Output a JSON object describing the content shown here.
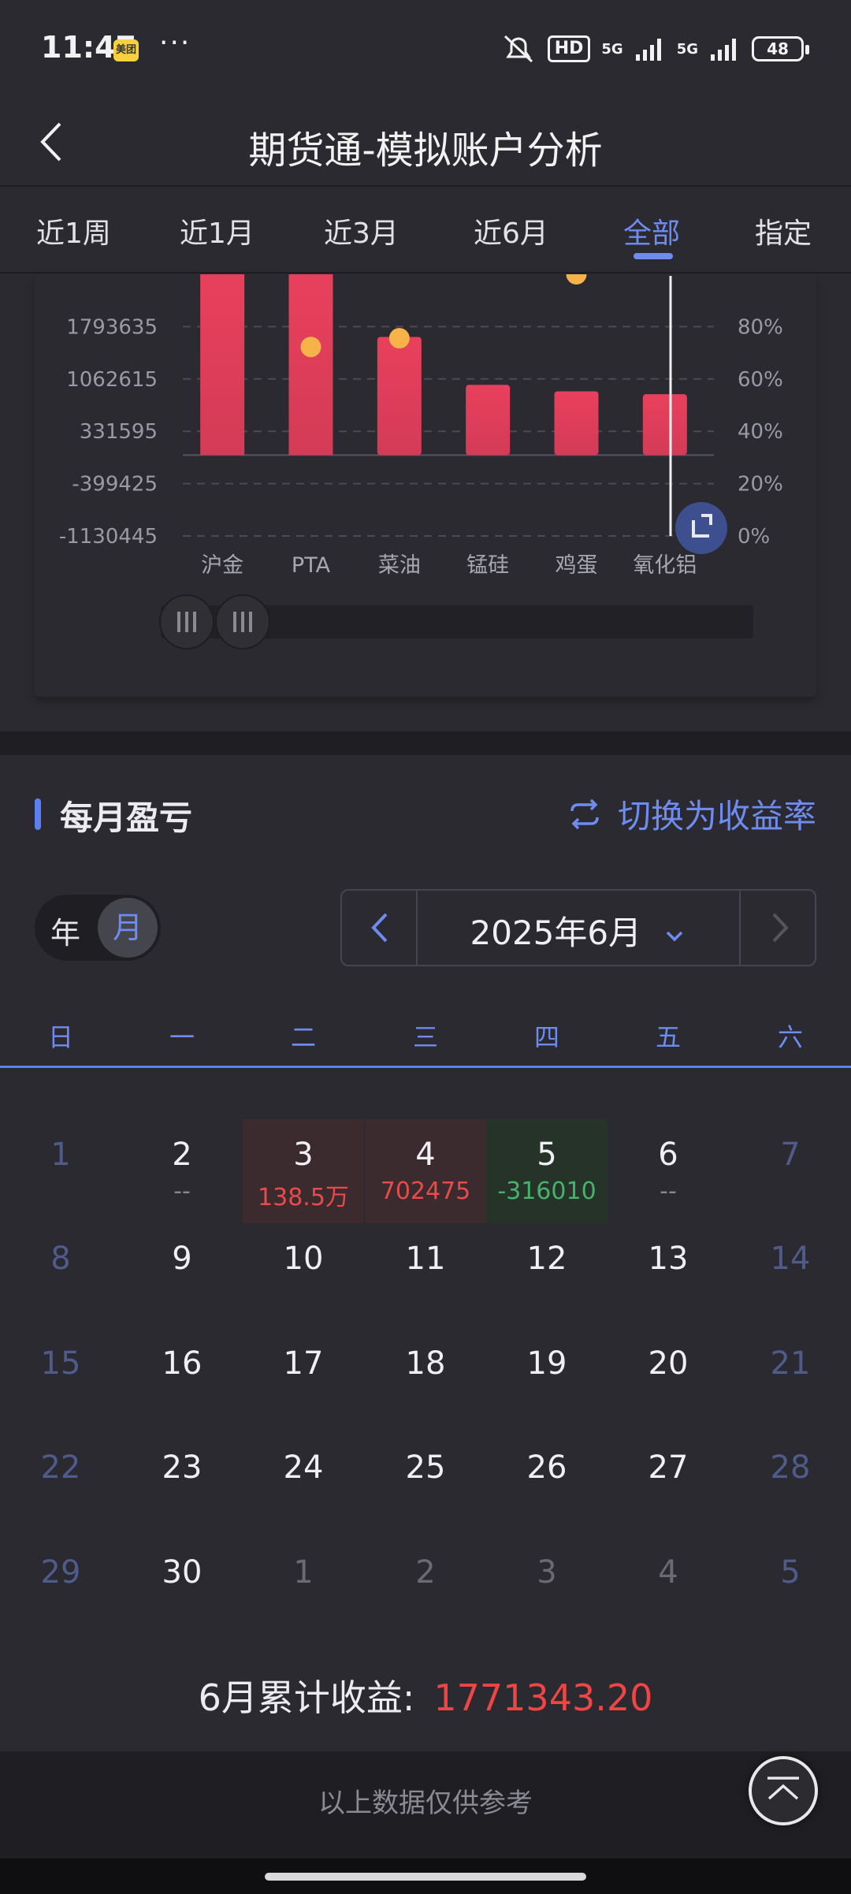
{
  "status_bar": {
    "time": "11:47",
    "app_badge": "美团",
    "dots": "···",
    "network": "HD",
    "net_5g_1": "5G",
    "net_5g_2": "5G",
    "battery": "48"
  },
  "header": {
    "title": "期货通-模拟账户分析"
  },
  "period_tabs": [
    {
      "label": "近1周",
      "active": false
    },
    {
      "label": "近1月",
      "active": false
    },
    {
      "label": "近3月",
      "active": false
    },
    {
      "label": "近6月",
      "active": false
    },
    {
      "label": "全部",
      "active": true
    },
    {
      "label": "指定",
      "active": false
    }
  ],
  "chart_data": {
    "type": "bar",
    "categories": [
      "沪金",
      "PTA",
      "菜油",
      "锰硅",
      "鸡蛋",
      "氧化铝"
    ],
    "values": [
      2524655,
      2524655,
      1650000,
      980000,
      890000,
      850000
    ],
    "rate_points": [
      null,
      65,
      68,
      null,
      90,
      null
    ],
    "y_left_ticks": [
      "1793635",
      "1062615",
      "331595",
      "-399425",
      "-1130445"
    ],
    "y_left_values": [
      1793635,
      1062615,
      331595,
      -399425,
      -1130445
    ],
    "y_right_ticks": [
      "80%",
      "60%",
      "40%",
      "20%",
      "0%"
    ],
    "ylim": [
      -1130445,
      2524655
    ],
    "y2lim": [
      0,
      90
    ],
    "bar_color": "#e8405c",
    "point_color": "#f7b24a",
    "grid": true
  },
  "monthly": {
    "title": "每月盈亏",
    "switch_label": "切换为收益率",
    "seg_year": "年",
    "seg_month": "月",
    "current_month": "2025年6月",
    "weekdays": [
      "日",
      "一",
      "二",
      "三",
      "四",
      "五",
      "六"
    ],
    "rows": [
      [
        {
          "d": "1",
          "v": "",
          "type": "weekend"
        },
        {
          "d": "2",
          "v": "--",
          "type": ""
        },
        {
          "d": "3",
          "v": "138.5万",
          "type": "up"
        },
        {
          "d": "4",
          "v": "702475",
          "type": "up"
        },
        {
          "d": "5",
          "v": "-316010",
          "type": "down"
        },
        {
          "d": "6",
          "v": "--",
          "type": ""
        },
        {
          "d": "7",
          "v": "",
          "type": "weekend"
        }
      ],
      [
        {
          "d": "8",
          "v": "",
          "type": "weekend"
        },
        {
          "d": "9",
          "v": "",
          "type": ""
        },
        {
          "d": "10",
          "v": "",
          "type": ""
        },
        {
          "d": "11",
          "v": "",
          "type": ""
        },
        {
          "d": "12",
          "v": "",
          "type": ""
        },
        {
          "d": "13",
          "v": "",
          "type": ""
        },
        {
          "d": "14",
          "v": "",
          "type": "weekend"
        }
      ],
      [
        {
          "d": "15",
          "v": "",
          "type": "weekend"
        },
        {
          "d": "16",
          "v": "",
          "type": ""
        },
        {
          "d": "17",
          "v": "",
          "type": ""
        },
        {
          "d": "18",
          "v": "",
          "type": ""
        },
        {
          "d": "19",
          "v": "",
          "type": ""
        },
        {
          "d": "20",
          "v": "",
          "type": ""
        },
        {
          "d": "21",
          "v": "",
          "type": "weekend"
        }
      ],
      [
        {
          "d": "22",
          "v": "",
          "type": "weekend"
        },
        {
          "d": "23",
          "v": "",
          "type": ""
        },
        {
          "d": "24",
          "v": "",
          "type": ""
        },
        {
          "d": "25",
          "v": "",
          "type": ""
        },
        {
          "d": "26",
          "v": "",
          "type": ""
        },
        {
          "d": "27",
          "v": "",
          "type": ""
        },
        {
          "d": "28",
          "v": "",
          "type": "weekend"
        }
      ],
      [
        {
          "d": "29",
          "v": "",
          "type": "weekend"
        },
        {
          "d": "30",
          "v": "",
          "type": ""
        },
        {
          "d": "1",
          "v": "",
          "type": "next"
        },
        {
          "d": "2",
          "v": "",
          "type": "next"
        },
        {
          "d": "3",
          "v": "",
          "type": "next"
        },
        {
          "d": "4",
          "v": "",
          "type": "next"
        },
        {
          "d": "5",
          "v": "",
          "type": "next weekend"
        }
      ]
    ],
    "total_label": "6月累计收益:",
    "total_value": "1771343.20"
  },
  "footer": {
    "note": "以上数据仅供参考"
  },
  "colors": {
    "accent": "#6e8cf0",
    "profit": "#ea4a4a",
    "loss": "#47b36a"
  }
}
